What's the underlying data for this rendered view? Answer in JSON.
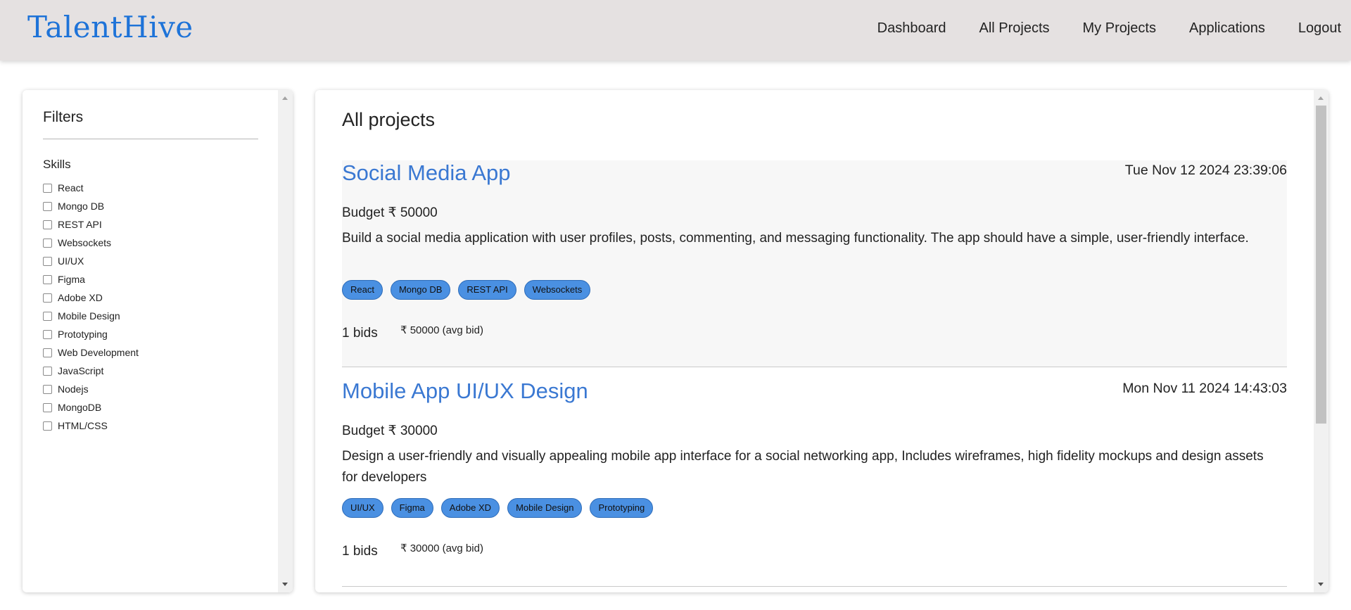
{
  "navbar": {
    "brand": "TalentHive",
    "links": [
      "Dashboard",
      "All Projects",
      "My Projects",
      "Applications",
      "Logout"
    ]
  },
  "filters": {
    "title": "Filters",
    "skills_heading": "Skills",
    "skills": [
      {
        "label": "React",
        "checked": false
      },
      {
        "label": "Mongo DB",
        "checked": false
      },
      {
        "label": "REST API",
        "checked": false
      },
      {
        "label": "Websockets",
        "checked": false
      },
      {
        "label": "UI/UX",
        "checked": false
      },
      {
        "label": "Figma",
        "checked": false
      },
      {
        "label": "Adobe XD",
        "checked": false
      },
      {
        "label": "Mobile Design",
        "checked": false
      },
      {
        "label": "Prototyping",
        "checked": false
      },
      {
        "label": "Web Development",
        "checked": false
      },
      {
        "label": "JavaScript",
        "checked": false
      },
      {
        "label": "Nodejs",
        "checked": false
      },
      {
        "label": "MongoDB",
        "checked": false
      },
      {
        "label": "HTML/CSS",
        "checked": false
      }
    ]
  },
  "projects": {
    "heading": "All projects",
    "items": [
      {
        "title": "Social Media App",
        "date": "Tue Nov 12 2024 23:39:06",
        "budget": "Budget ₹ 50000",
        "description": "Build a social media application with user profiles, posts, commenting, and messaging functionality. The app should have a simple, user-friendly interface.",
        "skills": [
          "React",
          "Mongo DB",
          "REST API",
          "Websockets"
        ],
        "bids": "1 bids",
        "avg_bid": "₹ 50000 (avg bid)"
      },
      {
        "title": "Mobile App UI/UX Design",
        "date": "Mon Nov 11 2024 14:43:03",
        "budget": "Budget ₹ 30000",
        "description": "Design a user-friendly and visually appealing mobile app interface for a social networking app, Includes wireframes, high fidelity mockups and design assets for developers",
        "skills": [
          "UI/UX",
          "Figma",
          "Adobe XD",
          "Mobile Design",
          "Prototyping"
        ],
        "bids": "1 bids",
        "avg_bid": "₹ 30000 (avg bid)"
      }
    ]
  },
  "colors": {
    "brand": "#1e73d8",
    "project_title": "#3a78d2",
    "tag_background": "#4a90e2",
    "navbar_background": "#e5e1e1"
  }
}
